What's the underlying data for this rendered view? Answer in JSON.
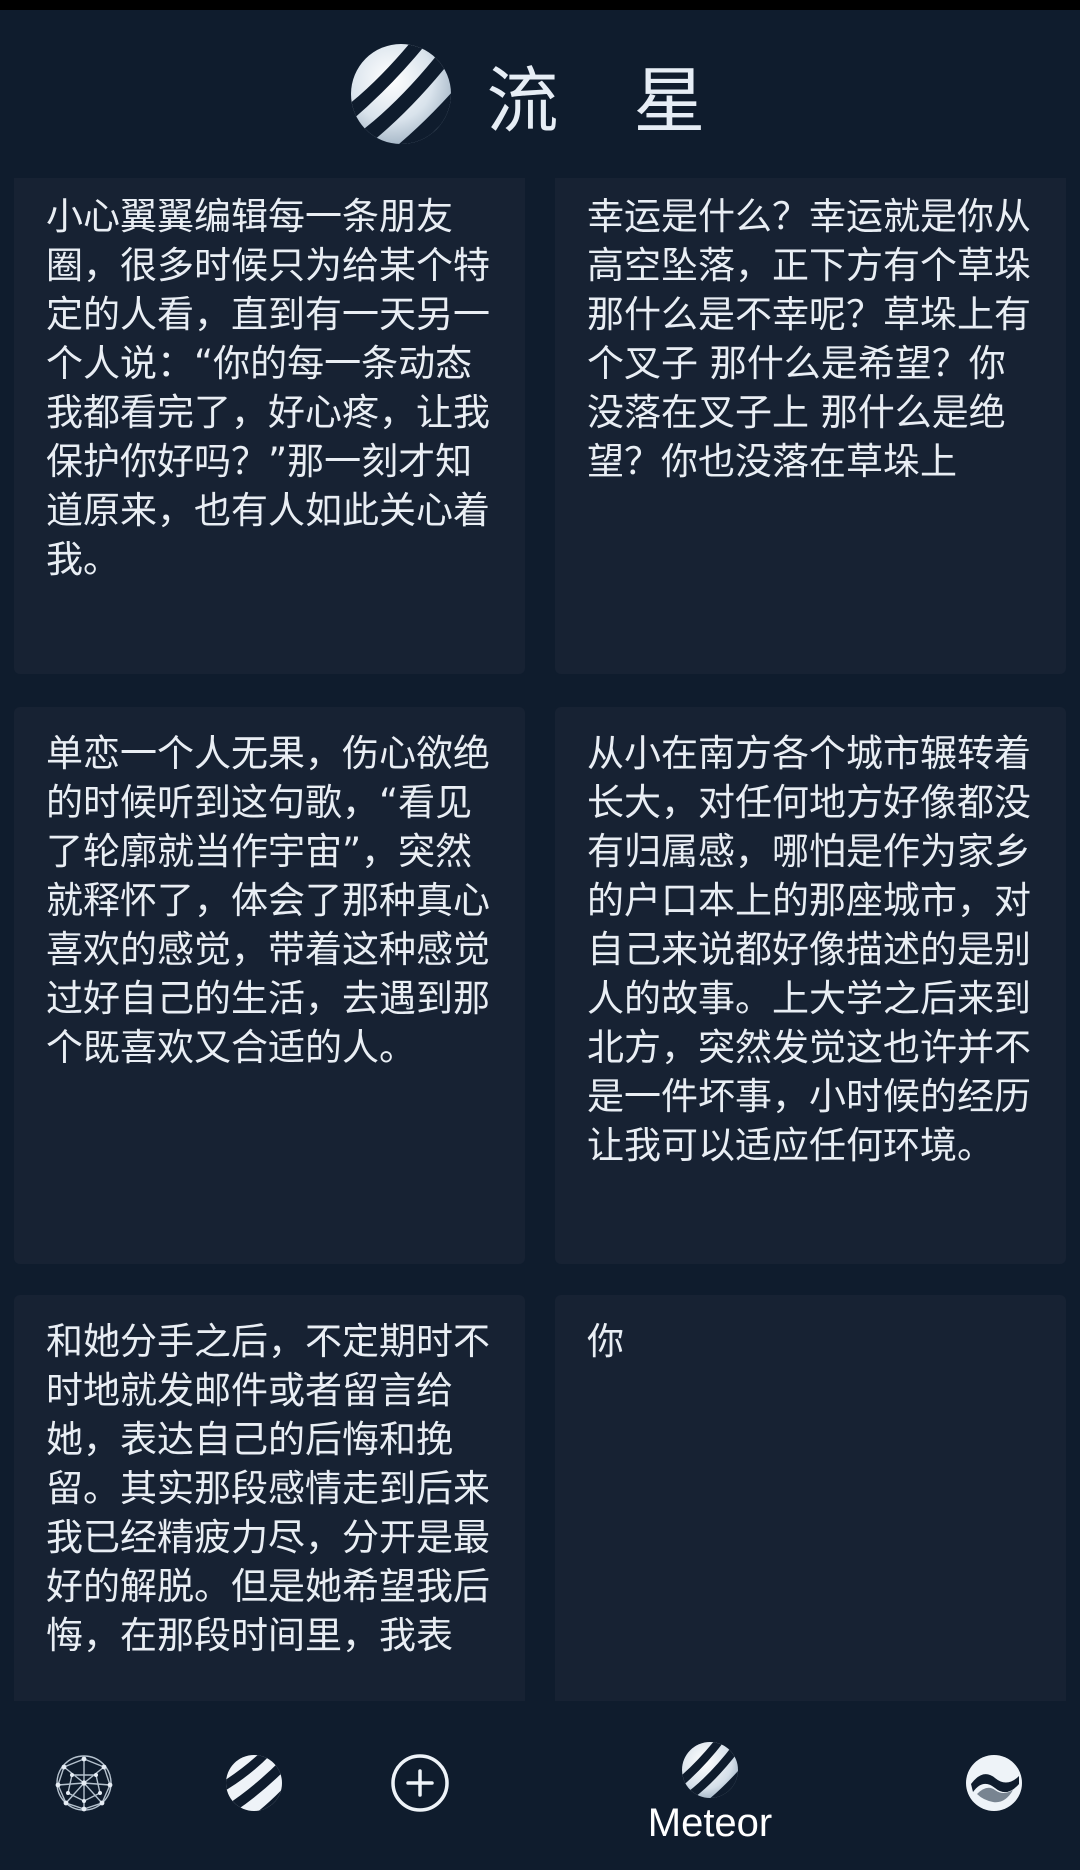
{
  "header": {
    "title": "流 星",
    "logo_icon": "meteor-globe-icon"
  },
  "cards": [
    {
      "text": "小心翼翼编辑每一条朋友圈，很多时候只为给某个特定的人看，直到有一天另一个人说：“你的每一条动态我都看完了，好心疼，让我保护你好吗？”那一刻才知道原来，也有人如此关心着我。"
    },
    {
      "text": "幸运是什么？幸运就是你从高空坠落，正下方有个草垛 那什么是不幸呢？草垛上有个叉子 那什么是希望？你没落在叉子上 那什么是绝望？你也没落在草垛上"
    },
    {
      "text": "单恋一个人无果，伤心欲绝的时候听到这句歌，“看见了轮廓就当作宇宙”，突然就释怀了，体会了那种真心喜欢的感觉，带着这种感觉过好自己的生活，去遇到那个既喜欢又合适的人。"
    },
    {
      "text": "从小在南方各个城市辗转着长大，对任何地方好像都没有归属感，哪怕是作为家乡的户口本上的那座城市，对自己来说都好像描述的是别人的故事。上大学之后来到北方，突然发觉这也许并不是一件坏事，小时候的经历让我可以适应任何环境。"
    },
    {
      "text": "和她分手之后，不定期时不时地就发邮件或者留言给她，表达自己的后悔和挽留。其实那段感情走到后来我已经精疲力尽，分开是最好的解脱。但是她希望我后悔，在那段时间里，我表"
    },
    {
      "text": "你"
    }
  ],
  "bottom_nav": {
    "items": [
      {
        "icon": "network-globe-icon"
      },
      {
        "icon": "striped-ball-icon"
      },
      {
        "icon": "add-circle-icon"
      },
      {
        "icon": "meteor-logo-icon",
        "label": "Meteor"
      },
      {
        "icon": "orbit-swirl-icon"
      }
    ]
  },
  "colors": {
    "background": "#0f1c2d",
    "card": "#172233",
    "text": "#e9eef4"
  }
}
